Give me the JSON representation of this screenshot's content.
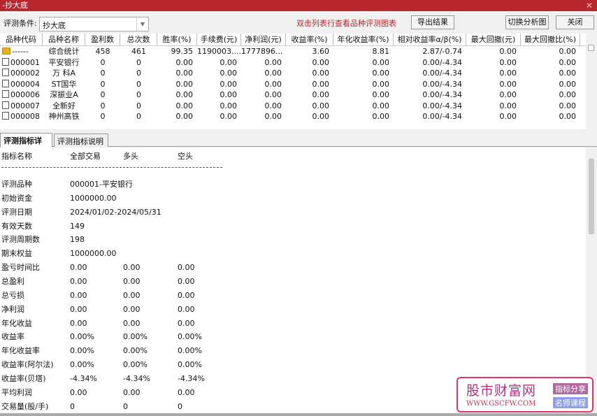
{
  "window": {
    "title": "-抄大底",
    "close": "✕"
  },
  "toolbar": {
    "condition_label": "评测条件:",
    "condition_value": "抄大底",
    "hint": "双击列表行查看品种评测图表",
    "export": "导出结果",
    "switch": "切换分析图",
    "close": "关闭"
  },
  "table": {
    "headers": [
      "品种代码",
      "品种名称",
      "盈利数",
      "总次数",
      "胜率(%)",
      "手续费(元)",
      "净利润(元)",
      "收益率(%)",
      "年化收益率(%)",
      "相对收益率α/β(%)",
      "最大回撤(元)",
      "最大回撤比(%)"
    ],
    "rows": [
      [
        "------",
        "综合统计",
        "458",
        "461",
        "99.35",
        "1190003....",
        "1777896...",
        "3.60",
        "8.81",
        "2.87/-0.74",
        "0.00",
        "0.00"
      ],
      [
        "000001",
        "平安银行",
        "0",
        "0",
        "0.00",
        "0.00",
        "0.00",
        "0.00",
        "0.00",
        "0.00/-4.34",
        "0.00",
        "0.00"
      ],
      [
        "000002",
        "万 科A",
        "0",
        "0",
        "0.00",
        "0.00",
        "0.00",
        "0.00",
        "0.00",
        "0.00/-4.34",
        "0.00",
        "0.00"
      ],
      [
        "000004",
        "ST国华",
        "0",
        "0",
        "0.00",
        "0.00",
        "0.00",
        "0.00",
        "0.00",
        "0.00/-4.34",
        "0.00",
        "0.00"
      ],
      [
        "000006",
        "深振业A",
        "0",
        "0",
        "0.00",
        "0.00",
        "0.00",
        "0.00",
        "0.00",
        "0.00/-4.34",
        "0.00",
        "0.00"
      ],
      [
        "000007",
        "全新好",
        "0",
        "0",
        "0.00",
        "0.00",
        "0.00",
        "0.00",
        "0.00",
        "0.00/-4.34",
        "0.00",
        "0.00"
      ],
      [
        "000008",
        "神州高铁",
        "0",
        "0",
        "0.00",
        "0.00",
        "0.00",
        "0.00",
        "0.00",
        "0.00/-4.34",
        "0.00",
        "0.00"
      ]
    ]
  },
  "tabs": [
    "评测指标详情",
    "评测指标说明"
  ],
  "detail": {
    "header": [
      "指标名称",
      "全部交易",
      "多头",
      "空头"
    ],
    "rows": [
      [
        "评测品种",
        "000001-平安银行",
        "",
        ""
      ],
      [
        "初始资金",
        "1000000.00",
        "",
        ""
      ],
      [
        "评测日期",
        "2024/01/02-2024/05/31",
        "",
        ""
      ],
      [
        "有效天数",
        "149",
        "",
        ""
      ],
      [
        "评测周期数",
        "198",
        "",
        ""
      ],
      [
        "期末权益",
        "1000000.00",
        "",
        ""
      ],
      [
        "盈亏时间比",
        "0.00",
        "0.00",
        "0.00"
      ],
      [
        "总盈利",
        "0.00",
        "0.00",
        "0.00"
      ],
      [
        "总亏损",
        "0.00",
        "0.00",
        "0.00"
      ],
      [
        "净利润",
        "0.00",
        "0.00",
        "0.00"
      ],
      [
        "年化收益",
        "0.00",
        "0.00",
        "0.00"
      ],
      [
        "收益率",
        "0.00%",
        "0.00%",
        "0.00%"
      ],
      [
        "年化收益率",
        "0.00%",
        "0.00%",
        "0.00%"
      ],
      [
        "收益率(阿尔法)",
        "0.00%",
        "0.00%",
        "0.00%"
      ],
      [
        "收益率(贝塔)",
        "-4.34%",
        "-4.34%",
        "-4.34%"
      ],
      [
        "平均利润",
        "0.00",
        "0.00",
        "0.00"
      ],
      [
        "交易量(股/手)",
        "0",
        "0",
        "0"
      ]
    ]
  },
  "ad": {
    "name": "股市财富网",
    "url": "WWW.GSCFW.COM",
    "tag1": "指标分享",
    "tag2": "名师课程"
  }
}
